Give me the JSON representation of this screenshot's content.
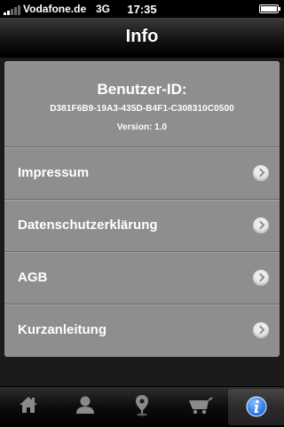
{
  "status_bar": {
    "carrier": "Vodafone.de",
    "network": "3G",
    "time": "17:35"
  },
  "nav": {
    "title": "Info"
  },
  "info": {
    "user_id_label": "Benutzer-ID:",
    "user_id_value": "D381F6B9-19A3-435D-B4F1-C308310C0500",
    "version": "Version: 1.0"
  },
  "menu": [
    {
      "label": "Impressum"
    },
    {
      "label": "Datenschutzerklärung"
    },
    {
      "label": "AGB"
    },
    {
      "label": "Kurzanleitung"
    }
  ],
  "tabs": [
    {
      "icon": "home-icon"
    },
    {
      "icon": "person-icon"
    },
    {
      "icon": "location-pin-icon"
    },
    {
      "icon": "cart-icon"
    },
    {
      "icon": "info-icon",
      "active": true
    }
  ],
  "colors": {
    "panel": "#8e8e8e",
    "info_accent": "#1e78ff"
  }
}
